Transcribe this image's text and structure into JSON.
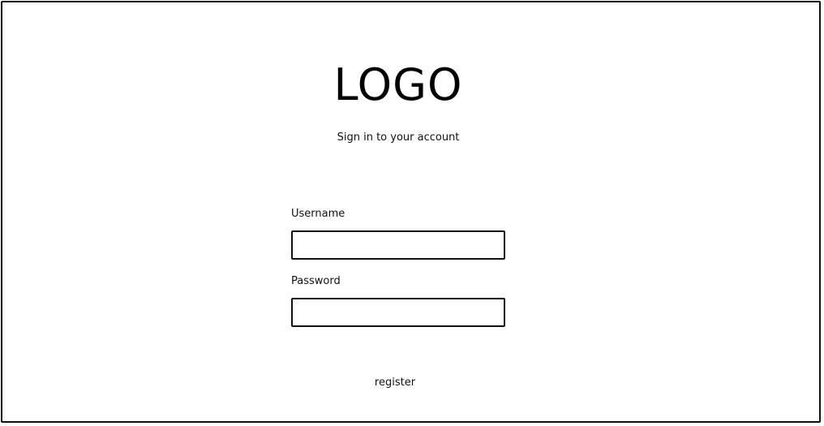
{
  "header": {
    "logo_text": "LOGO",
    "subtitle": "Sign in to your account"
  },
  "form": {
    "username_label": "Username",
    "username_value": "",
    "password_label": "Password",
    "password_value": ""
  },
  "footer": {
    "register_link": "register"
  }
}
